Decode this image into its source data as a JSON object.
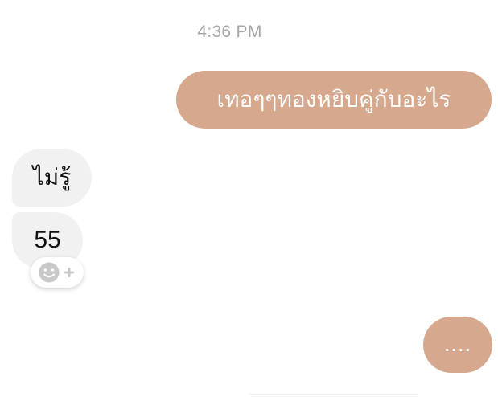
{
  "conversation": {
    "timestamp": "4:36 PM",
    "messages": [
      {
        "direction": "outgoing",
        "text": "เทอๆๆทองหยิบคู่กับอะไร"
      },
      {
        "direction": "incoming",
        "text": "ไม่รู้"
      },
      {
        "direction": "incoming",
        "text": "55"
      }
    ],
    "typing_indicator": "....",
    "reaction_button": {
      "icon": "smiley-plus-icon"
    }
  },
  "colors": {
    "outgoing_bubble": "#d6a88d",
    "incoming_bubble": "#f1f1f1",
    "timestamp_text": "#a6a6a6",
    "reaction_icon": "#c8c8c8"
  }
}
